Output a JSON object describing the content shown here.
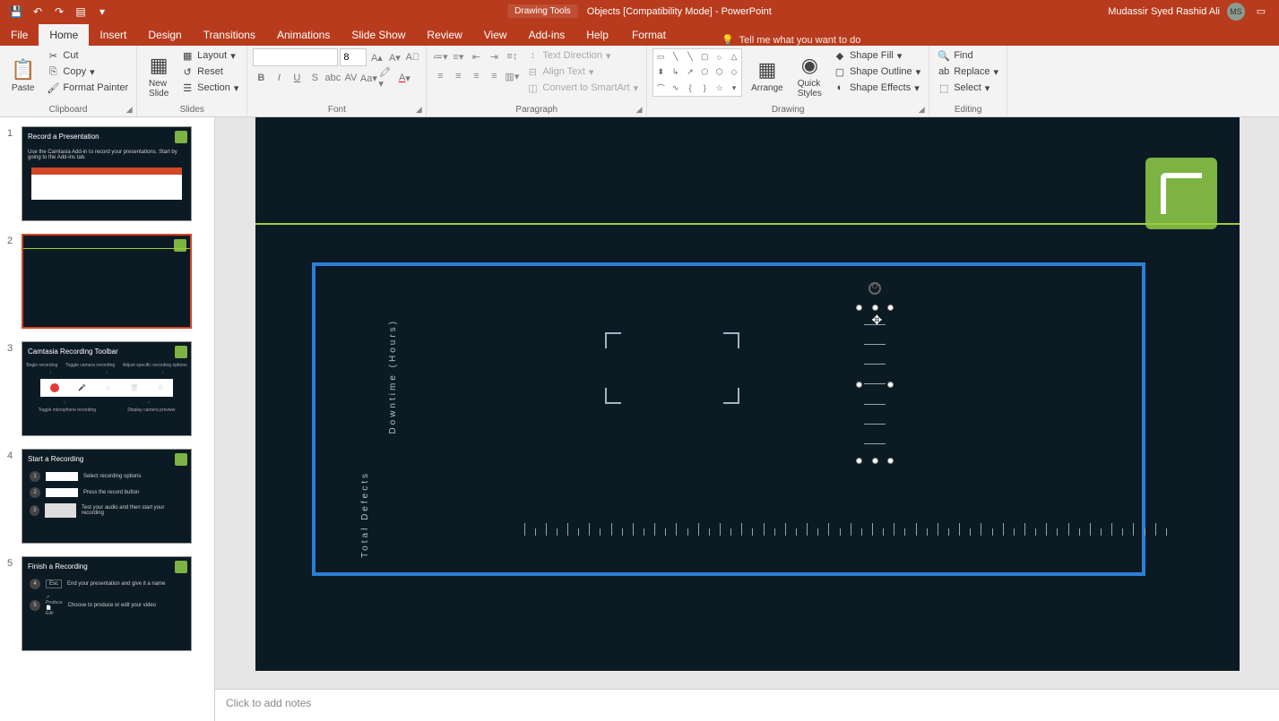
{
  "titlebar": {
    "drawing_tools": "Drawing Tools",
    "doc_title": "Objects [Compatibility Mode]  -  PowerPoint",
    "user_name": "Mudassir Syed Rashid Ali",
    "user_initials": "MS"
  },
  "tabs": {
    "file": "File",
    "home": "Home",
    "insert": "Insert",
    "design": "Design",
    "transitions": "Transitions",
    "animations": "Animations",
    "slideshow": "Slide Show",
    "review": "Review",
    "view": "View",
    "addins": "Add-ins",
    "help": "Help",
    "format": "Format",
    "tellme": "Tell me what you want to do"
  },
  "ribbon": {
    "clipboard": {
      "label": "Clipboard",
      "paste": "Paste",
      "cut": "Cut",
      "copy": "Copy",
      "format_painter": "Format Painter"
    },
    "slides": {
      "label": "Slides",
      "new_slide": "New\nSlide",
      "layout": "Layout",
      "reset": "Reset",
      "section": "Section"
    },
    "font": {
      "label": "Font",
      "size": "8"
    },
    "paragraph": {
      "label": "Paragraph",
      "text_direction": "Text Direction",
      "align_text": "Align Text",
      "convert_smartart": "Convert to SmartArt"
    },
    "drawing": {
      "label": "Drawing",
      "arrange": "Arrange",
      "quick_styles": "Quick\nStyles",
      "shape_fill": "Shape Fill",
      "shape_outline": "Shape Outline",
      "shape_effects": "Shape Effects"
    },
    "editing": {
      "label": "Editing",
      "find": "Find",
      "replace": "Replace",
      "select": "Select"
    }
  },
  "thumbnails": [
    {
      "num": "1",
      "title": "Record a Presentation",
      "body": "Use the Camtasia Add-in to record your presentations. Start by going to the Add-ins tab."
    },
    {
      "num": "2",
      "title": ""
    },
    {
      "num": "3",
      "title": "Camtasia Recording Toolbar",
      "c1": "Begin recording",
      "c2": "Toggle camera recording",
      "c3": "Adjust specific recording options",
      "c4": "Toggle microphone recording",
      "c5": "Display camera preview"
    },
    {
      "num": "4",
      "title": "Start a Recording",
      "r1": "Select recording options",
      "r2": "Press the record button",
      "r3": "Test your audio and then start your recording"
    },
    {
      "num": "5",
      "title": "Finish a Recording",
      "r1": "End your presentation and give it a name",
      "r2": "Choose to produce or edit your video",
      "esc": "Esc",
      "produce": "Produce",
      "edit": "Edit"
    }
  ],
  "slide": {
    "y_label_1": "Downtime (Hours)",
    "y_label_2": "Total Defects"
  },
  "notes": {
    "placeholder": "Click to add notes"
  }
}
